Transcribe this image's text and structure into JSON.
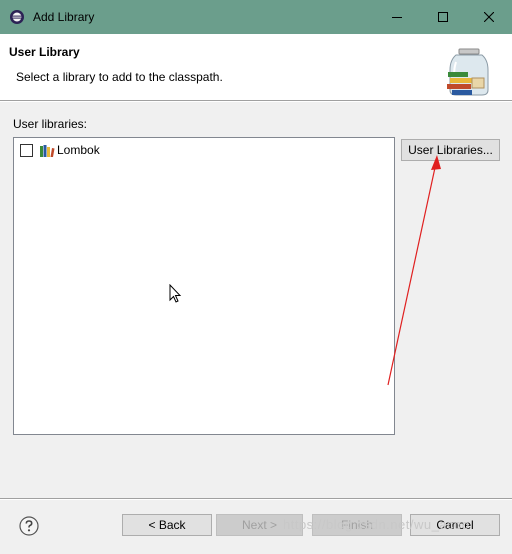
{
  "window": {
    "title": "Add Library"
  },
  "header": {
    "title": "User Library",
    "description": "Select a library to add to the classpath."
  },
  "list": {
    "label": "User libraries:",
    "items": [
      {
        "label": "Lombok",
        "checked": false
      }
    ]
  },
  "buttons": {
    "user_libraries": "User Libraries...",
    "back": "< Back",
    "next": "Next >",
    "finish": "Finish",
    "cancel": "Cancel"
  },
  "watermark": "https://blog.csdn.net/wu_acoo",
  "colors": {
    "titlebar": "#6b9e8c",
    "annotation_arrow": "#e02020"
  }
}
